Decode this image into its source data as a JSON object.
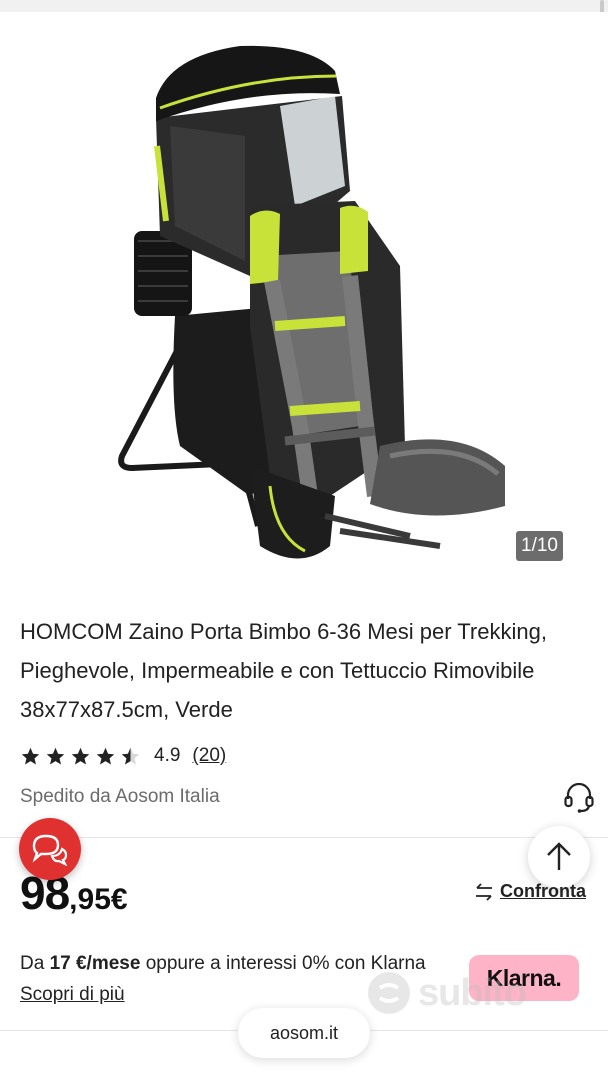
{
  "gallery": {
    "image_alt": "product-photo-baby-carrier-backpack",
    "counter": "1/10"
  },
  "product": {
    "title": "HOMCOM Zaino Porta Bimbo 6-36 Mesi per Trekking, Pieghevole, Impermeabile e con Tettuccio Rimovibile 38x77x87.5cm, Verde",
    "rating_value": "4.9",
    "rating_stars": 4.5,
    "rating_count": "(20)",
    "shipped_by": "Spedito da Aosom Italia"
  },
  "price": {
    "integer": "98",
    "decimal": ",95€"
  },
  "compare": {
    "label": "Confronta"
  },
  "klarna": {
    "prefix": "Da ",
    "amount": "17 €/mese",
    "middle": " oppure a interessi 0% con Klarna ",
    "link": "Scopri di più",
    "badge": "Klarna."
  },
  "watermark": {
    "text": "subito"
  },
  "browser": {
    "url": "aosom.it"
  },
  "icons": {
    "headset": "headset-icon",
    "chat": "chat-bubbles-icon",
    "scroll_top": "arrow-up-icon",
    "compare": "swap-arrows-icon"
  },
  "colors": {
    "chat_fab": "#e03131",
    "klarna_badge": "#ffb3c7",
    "carrier_accent": "#c8e23a"
  }
}
